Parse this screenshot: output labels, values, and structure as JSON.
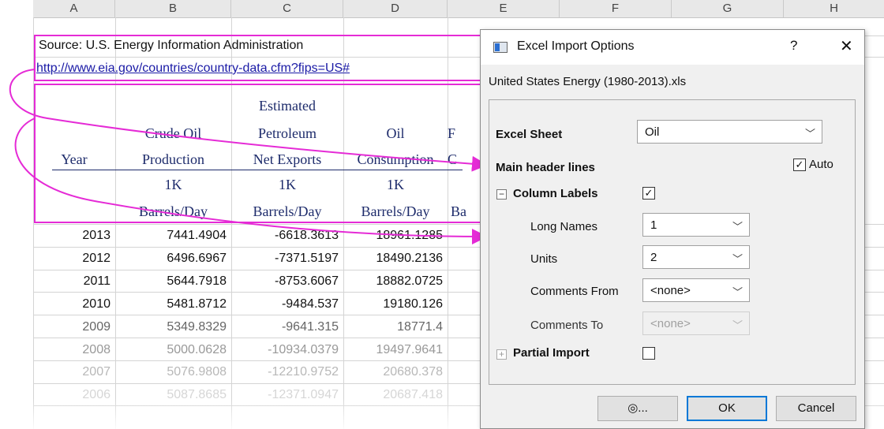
{
  "sheet": {
    "columns": [
      "A",
      "B",
      "C",
      "D",
      "E",
      "F",
      "G",
      "H"
    ],
    "source_text": "Source: U.S. Energy Information Administration",
    "url_text": "http://www.eia.gov/countries/country-data.cfm?fips=US#",
    "headers": {
      "year": "Year",
      "crude_line1": "Crude Oil",
      "crude_line2": "Production",
      "crude_unit1": "1K",
      "crude_unit2": "Barrels/Day",
      "pet_line1": "Estimated",
      "pet_line2": "Petroleum",
      "pet_line3": "Net Exports",
      "pet_unit1": "1K",
      "pet_unit2": "Barrels/Day",
      "oil_line1": "Oil",
      "oil_line2": "Consumption",
      "oil_unit1": "1K",
      "oil_unit2": "Barrels/Day",
      "e_frag1": "F",
      "e_frag2": "C",
      "e_frag3": "Ba"
    },
    "rows": [
      {
        "year": "2013",
        "b": "7441.4904",
        "c": "-6618.3613",
        "d": "18961.1285"
      },
      {
        "year": "2012",
        "b": "6496.6967",
        "c": "-7371.5197",
        "d": "18490.2136"
      },
      {
        "year": "2011",
        "b": "5644.7918",
        "c": "-8753.6067",
        "d": "18882.0725"
      },
      {
        "year": "2010",
        "b": "5481.8712",
        "c": "-9484.537",
        "d": "19180.126"
      },
      {
        "year": "2009",
        "b": "5349.8329",
        "c": "-9641.315",
        "d": "18771.4"
      },
      {
        "year": "2008",
        "b": "5000.0628",
        "c": "-10934.0379",
        "d": "19497.9641"
      },
      {
        "year": "2007",
        "b": "5076.9808",
        "c": "-12210.9752",
        "d": "20680.378"
      },
      {
        "year": "2006",
        "b": "5087.8685",
        "c": "-12371.0947",
        "d": "20687.418"
      }
    ]
  },
  "dialog": {
    "title": "Excel Import Options",
    "help_label": "?",
    "close_label": "✕",
    "filename": "United States Energy (1980-2013).xls",
    "excel_sheet_label": "Excel Sheet",
    "excel_sheet_value": "Oil",
    "main_header_label": "Main header lines",
    "auto_label": "Auto",
    "column_labels_label": "Column Labels",
    "long_names_label": "Long Names",
    "long_names_value": "1",
    "units_label": "Units",
    "units_value": "2",
    "comments_from_label": "Comments From",
    "comments_from_value": "<none>",
    "comments_to_label": "Comments To",
    "comments_to_value": "<none>",
    "partial_import_label": "Partial Import",
    "settings_button_label": "◎...",
    "ok_label": "OK",
    "cancel_label": "Cancel",
    "checkmark": "✓",
    "expander_minus": "−",
    "expander_plus": "+",
    "dropdown_arrow": "﹀"
  },
  "colors": {
    "annotation": "#e52bd6",
    "header_text": "#1d2b6b",
    "url": "#1a1aa6",
    "accent": "#0078d7"
  }
}
